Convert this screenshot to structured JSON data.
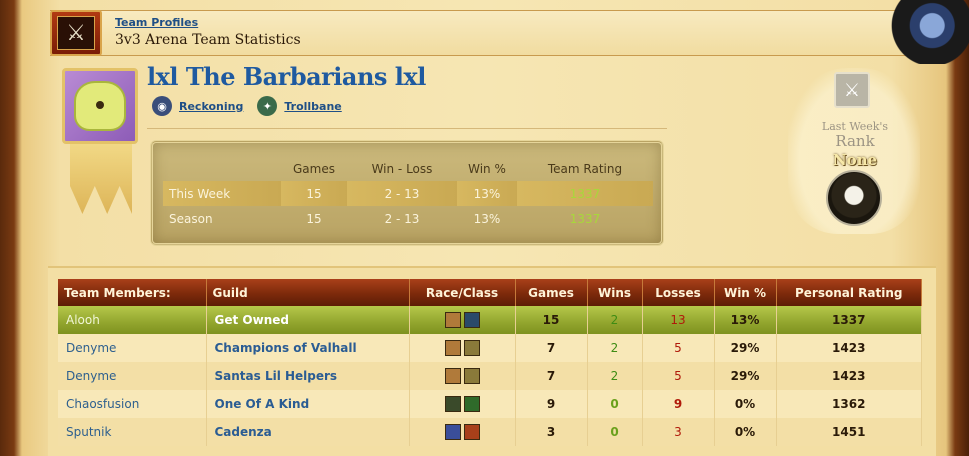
{
  "header": {
    "breadcrumb": "Team Profiles",
    "title": "3v3 Arena Team Statistics"
  },
  "team": {
    "name": "lxl The Barbarians lxl",
    "battlegroup": "Reckoning",
    "realm": "Trollbane",
    "emblem_colors": {
      "background": "#9a6cc4",
      "emblem": "#e2ea7a"
    }
  },
  "stats": {
    "headers": [
      "",
      "Games",
      "Win - Loss",
      "Win %",
      "Team Rating"
    ],
    "rows": [
      {
        "label": "This Week",
        "games": "15",
        "win_loss": "2 - 13",
        "win_pct": "13%",
        "rating": "1337"
      },
      {
        "label": "Season",
        "games": "15",
        "win_loss": "2 - 13",
        "win_pct": "13%",
        "rating": "1337"
      }
    ]
  },
  "rank": {
    "label_line1": "Last Week's",
    "label_line2": "Rank",
    "value": "None"
  },
  "members": {
    "headers": [
      "Team Members:",
      "Guild",
      "Race/Class",
      "Games",
      "Wins",
      "Losses",
      "Win %",
      "Personal Rating"
    ],
    "rows": [
      {
        "name": "Alooh",
        "guild": "Get Owned",
        "race_icon": "human-male-icon",
        "class_icon": "warrior-icon",
        "games": "15",
        "wins": "2",
        "losses": "13",
        "win_pct": "13%",
        "rating": "1337"
      },
      {
        "name": "Denyme",
        "guild": "Champions of Valhall",
        "race_icon": "human-male-icon",
        "class_icon": "paladin-icon",
        "games": "7",
        "wins": "2",
        "losses": "5",
        "win_pct": "29%",
        "rating": "1423"
      },
      {
        "name": "Denyme",
        "guild": "Santas Lil Helpers",
        "race_icon": "human-male-icon",
        "class_icon": "paladin-icon",
        "games": "7",
        "wins": "2",
        "losses": "5",
        "win_pct": "29%",
        "rating": "1423"
      },
      {
        "name": "Chaosfusion",
        "guild": "One Of A Kind",
        "race_icon": "undead-icon",
        "class_icon": "hunter-icon",
        "games": "9",
        "wins": "0",
        "losses": "9",
        "win_pct": "0%",
        "rating": "1362"
      },
      {
        "name": "Sputnik",
        "guild": "Cadenza",
        "race_icon": "draenei-icon",
        "class_icon": "shaman-icon",
        "games": "3",
        "wins": "0",
        "losses": "3",
        "win_pct": "0%",
        "rating": "1451"
      }
    ]
  },
  "colors": {
    "link": "#1f4f86",
    "header_bar": "#8a300f",
    "highlight_row": "#9fb43a",
    "win": "#3f8c14",
    "loss": "#b01a0a"
  }
}
